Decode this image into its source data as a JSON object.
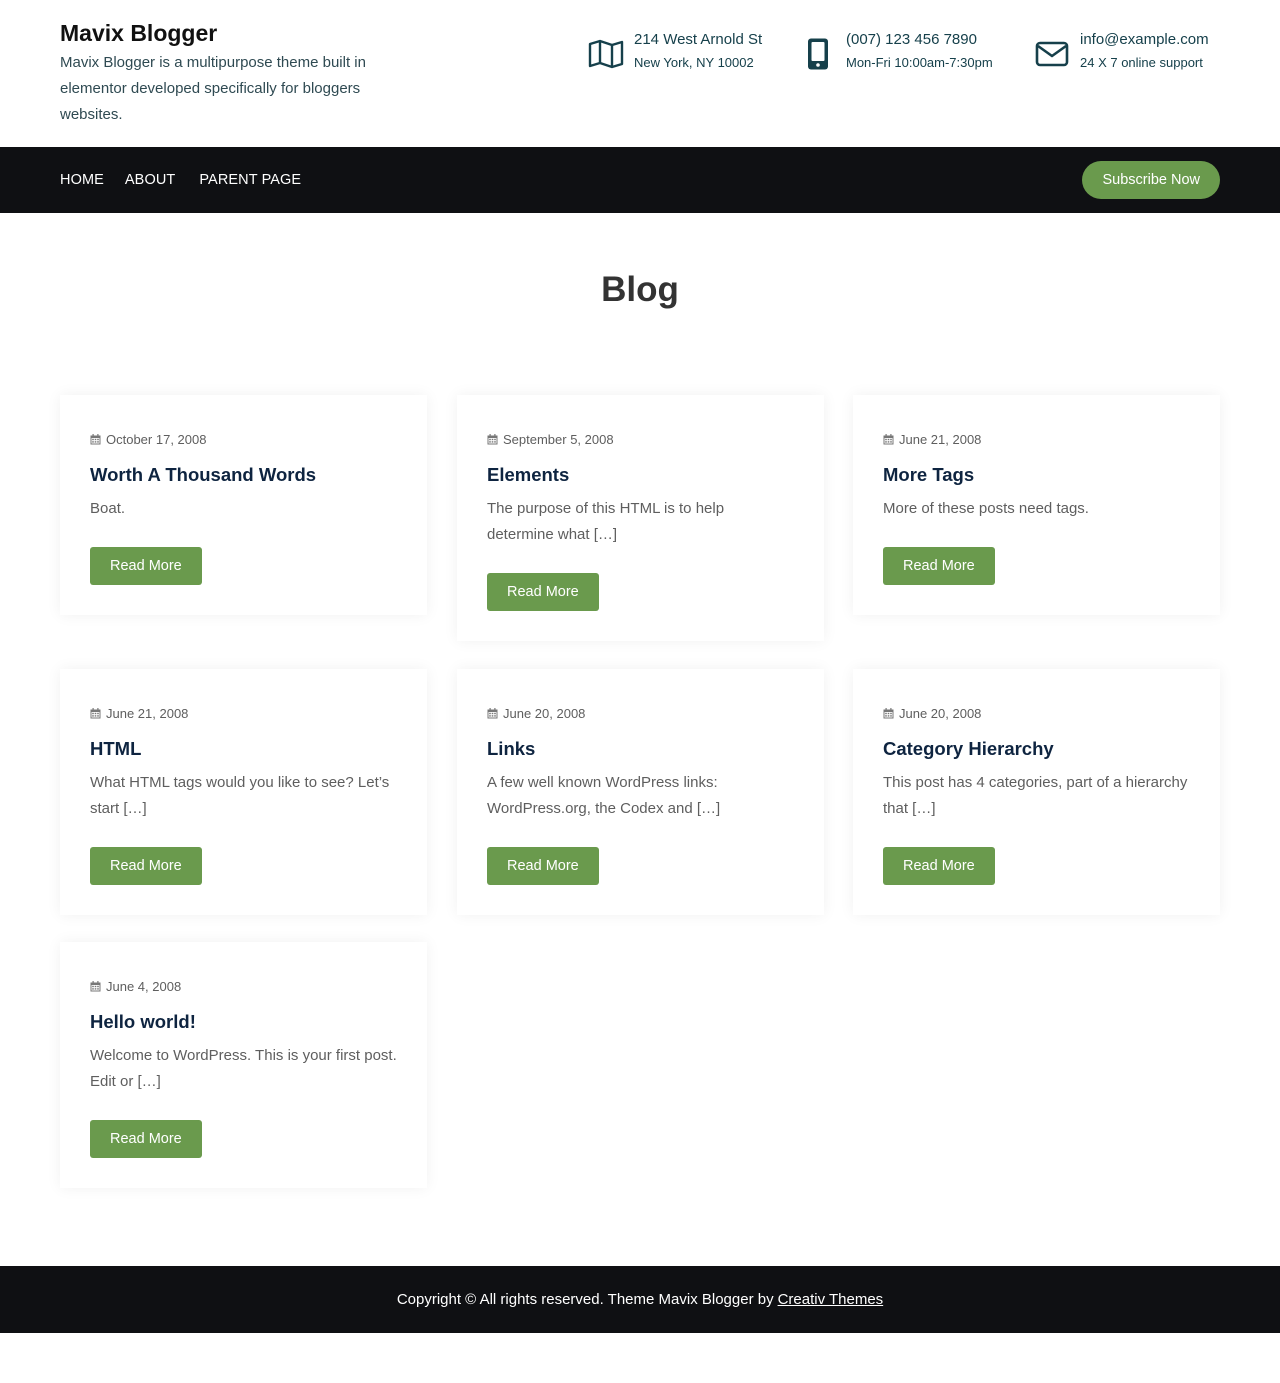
{
  "header": {
    "site_title": "Mavix Blogger",
    "site_desc": "Mavix Blogger is a multipurpose theme built in elementor developed specifically for bloggers websites.",
    "contacts": [
      {
        "icon": "map-icon",
        "line1": "214 West Arnold St",
        "line2": "New York, NY 10002"
      },
      {
        "icon": "phone-icon",
        "line1": "(007) 123 456 7890",
        "line2": "Mon-Fri 10:00am-7:30pm"
      },
      {
        "icon": "mail-icon",
        "line1": "info@example.com",
        "line2": "24 X 7 online support"
      }
    ]
  },
  "nav": {
    "items": [
      "HOME",
      "ABOUT",
      "PARENT PAGE"
    ],
    "subscribe": "Subscribe Now"
  },
  "page_title": "Blog",
  "posts": [
    {
      "date": "October 17, 2008",
      "title": "Worth A Thousand Words",
      "excerpt": "Boat.",
      "button": "Read More"
    },
    {
      "date": "September 5, 2008",
      "title": "Elements",
      "excerpt": "The purpose of this HTML is to help determine what […]",
      "button": "Read More"
    },
    {
      "date": "June 21, 2008",
      "title": "More Tags",
      "excerpt": "More of these posts need tags.",
      "button": "Read More"
    },
    {
      "date": "June 21, 2008",
      "title": "HTML",
      "excerpt": "What HTML tags would you like to see? Let’s start […]",
      "button": "Read More"
    },
    {
      "date": "June 20, 2008",
      "title": "Links",
      "excerpt": "A few well known WordPress links: WordPress.org, the Codex and […]",
      "button": "Read More"
    },
    {
      "date": "June 20, 2008",
      "title": "Category Hierarchy",
      "excerpt": "This post has 4 categories, part of a hierarchy that […]",
      "button": "Read More"
    },
    {
      "date": "June 4, 2008",
      "title": "Hello world!",
      "excerpt": "Welcome to WordPress. This is your first post. Edit or […]",
      "button": "Read More"
    }
  ],
  "footer": {
    "text": "Copyright © All rights reserved. Theme Mavix Blogger by",
    "link": "Creativ Themes"
  },
  "colors": {
    "accent_green": "#6a9a4d",
    "nav_bg": "#0f1013",
    "heading_navy": "#0e2440",
    "contact_teal": "#16404b"
  }
}
